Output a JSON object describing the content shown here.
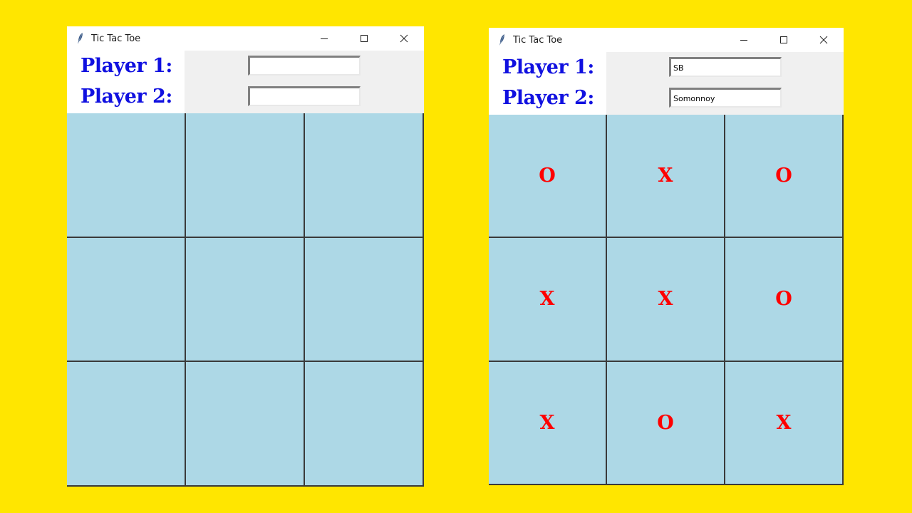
{
  "background_color": "#FFE600",
  "label_color": "#1010E0",
  "mark_color": "#FF0000",
  "board_color": "#ADD8E6",
  "windows": [
    {
      "title": "Tic Tac Toe",
      "player1_label": "Player 1:",
      "player2_label": "Player 2:",
      "player1_value": "",
      "player2_value": "",
      "cells": [
        "",
        "",
        "",
        "",
        "",
        "",
        "",
        "",
        ""
      ]
    },
    {
      "title": "Tic Tac Toe",
      "player1_label": "Player 1:",
      "player2_label": "Player 2:",
      "player1_value": "SB",
      "player2_value": "Somonnoy",
      "cells": [
        "O",
        "X",
        "O",
        "X",
        "X",
        "O",
        "X",
        "O",
        "X"
      ]
    }
  ]
}
